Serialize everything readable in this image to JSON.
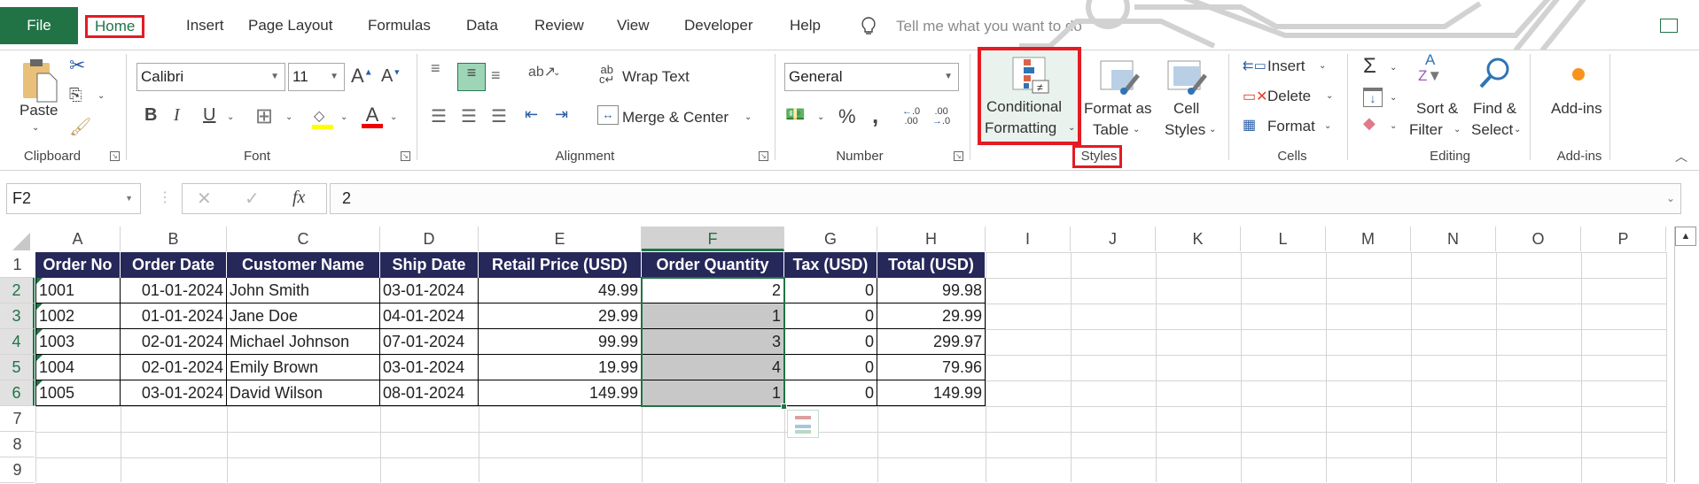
{
  "tabs": {
    "items": [
      "File",
      "Home",
      "Insert",
      "Page Layout",
      "Formulas",
      "Data",
      "Review",
      "View",
      "Developer",
      "Help"
    ],
    "active": "Home",
    "tell_me_placeholder": "Tell me what you want to do"
  },
  "ribbon": {
    "clipboard": {
      "label": "Clipboard",
      "paste": "Paste"
    },
    "font": {
      "label": "Font",
      "font_name": "Calibri",
      "font_size": "11",
      "bold": "B",
      "italic": "I",
      "underline": "U"
    },
    "alignment": {
      "label": "Alignment",
      "wrap_text": "Wrap Text",
      "merge_center": "Merge & Center"
    },
    "number": {
      "label": "Number",
      "format": "General",
      "percent": "%",
      "comma": ","
    },
    "styles": {
      "label": "Styles",
      "conditional_formatting_1": "Conditional",
      "conditional_formatting_2": "Formatting",
      "format_as_table_1": "Format as",
      "format_as_table_2": "Table",
      "cell_styles_1": "Cell",
      "cell_styles_2": "Styles"
    },
    "cells": {
      "label": "Cells",
      "insert": "Insert",
      "delete": "Delete",
      "format": "Format"
    },
    "editing": {
      "label": "Editing",
      "sort_1": "Sort &",
      "sort_2": "Filter",
      "find_1": "Find &",
      "find_2": "Select"
    },
    "addins": {
      "label": "Add-ins",
      "addins": "Add-ins"
    }
  },
  "formula_bar": {
    "name_box": "F2",
    "fx": "fx",
    "value": "2"
  },
  "sheet": {
    "columns": [
      "A",
      "B",
      "C",
      "D",
      "E",
      "F",
      "G",
      "H",
      "I",
      "J",
      "K",
      "L",
      "M",
      "N",
      "O",
      "P"
    ],
    "rows": [
      "1",
      "2",
      "3",
      "4",
      "5",
      "6",
      "7",
      "8",
      "9"
    ],
    "selected_column": "F",
    "headers": [
      "Order No",
      "Order Date",
      "Customer Name",
      "Ship Date",
      "Retail Price (USD)",
      "Order Quantity",
      "Tax (USD)",
      "Total (USD)"
    ],
    "data": [
      [
        "1001",
        "01-01-2024",
        "John Smith",
        "03-01-2024",
        "49.99",
        "2",
        "0",
        "99.98"
      ],
      [
        "1002",
        "01-01-2024",
        "Jane Doe",
        "04-01-2024",
        "29.99",
        "1",
        "0",
        "29.99"
      ],
      [
        "1003",
        "02-01-2024",
        "Michael Johnson",
        "07-01-2024",
        "99.99",
        "3",
        "0",
        "299.97"
      ],
      [
        "1004",
        "02-01-2024",
        "Emily Brown",
        "03-01-2024",
        "19.99",
        "4",
        "0",
        "79.96"
      ],
      [
        "1005",
        "03-01-2024",
        "David Wilson",
        "08-01-2024",
        "149.99",
        "1",
        "0",
        "149.99"
      ]
    ]
  },
  "colors": {
    "excel_green": "#217346",
    "header_fill": "#262859",
    "highlight_red": "#e41b23",
    "selection_fill": "#c8c8c8"
  }
}
